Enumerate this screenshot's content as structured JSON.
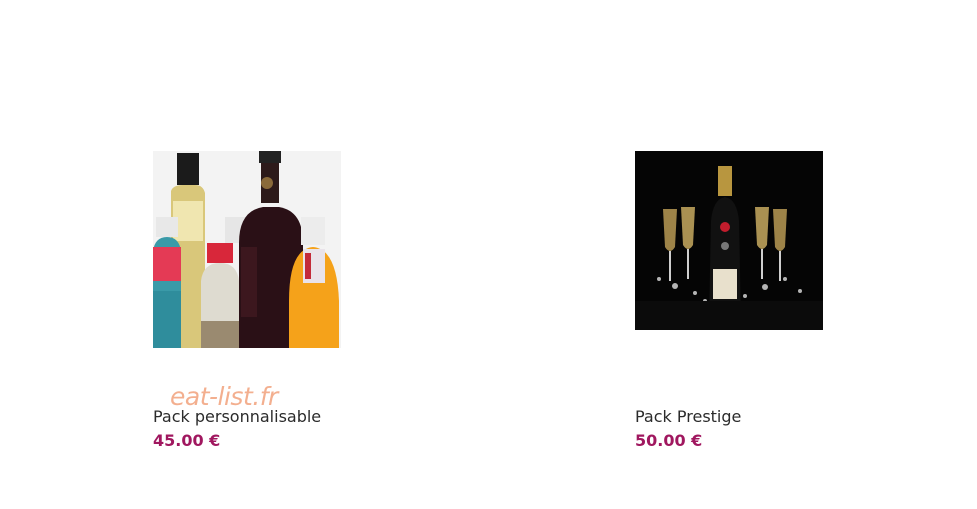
{
  "products": [
    {
      "name": "Pack personnalisable",
      "price": "45.00 €",
      "image_icon": "assorted-bottles-image"
    },
    {
      "name": "Pack Prestige",
      "price": "50.00 €",
      "image_icon": "champagne-bottle-glasses-image"
    }
  ],
  "watermark": "eat-list.fr",
  "colors": {
    "price": "#a0175f",
    "name": "#2b2b2b",
    "watermark": "#f2a27c"
  }
}
